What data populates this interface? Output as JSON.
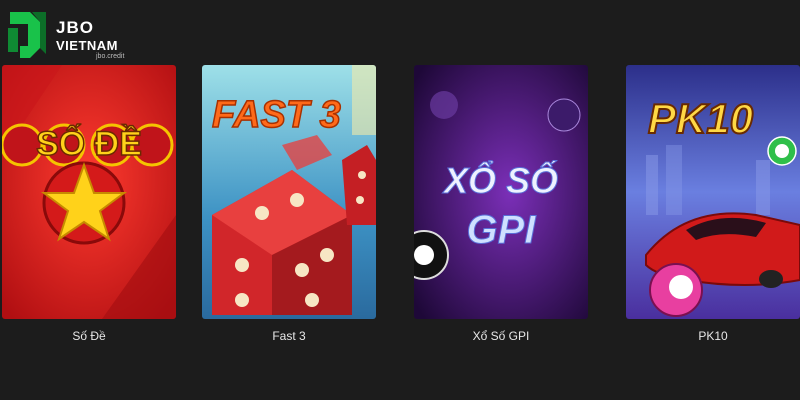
{
  "logo": {
    "line1": "JBO",
    "line2": "VIETNAM",
    "sub": "jbo.credit"
  },
  "games": [
    {
      "label": "Số Đề",
      "art_text": "SỐ ĐỀ"
    },
    {
      "label": "Fast 3",
      "art_text": "FAST 3"
    },
    {
      "label": "Xổ Số GPI",
      "art_text_1": "XỔ SỐ",
      "art_text_2": "GPI"
    },
    {
      "label": "PK10",
      "art_text": "PK10"
    }
  ],
  "colors": {
    "background": "#1c1c1c",
    "logo_green": "#19c24a",
    "so_de_red": "#d41a1a",
    "fast3_teal": "#5fb7c9",
    "gpi_purple": "#3a1260",
    "pk10_blue": "#4a4fbf"
  }
}
